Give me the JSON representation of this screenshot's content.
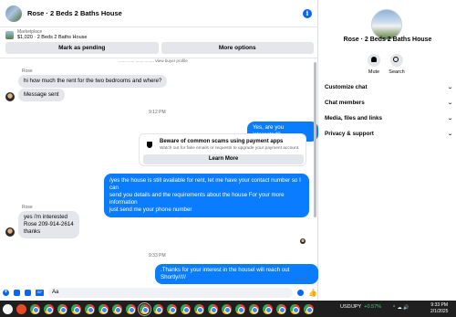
{
  "header": {
    "title": "Rose · 2 Beds 2 Baths House"
  },
  "listing": {
    "label": "Marketplace",
    "price_title": "$1,020 · 2 Beds 2 Baths House"
  },
  "actions": {
    "mark_pending": "Mark as pending",
    "more_options": "More options"
  },
  "thread": {
    "notice_top": "....... ...... ....... ........ View buyer profile",
    "msg1_sender": "Rose",
    "msg1_a": "hi how much the rent for the two bedrooms and where?",
    "msg1_b": "Message sent",
    "time1": "9:12 PM",
    "out1": "Yes, are you interested?",
    "scam_title": "Beware of common scams using payment apps",
    "scam_body": "Watch out for fake emails or requests to upgrade your payment account.",
    "learn_more": "Learn More",
    "out2_l1": "/yes the house is still available for rent, let me have your contact number so I can",
    "out2_l2": "send you details and the requirements about the house For  your  more  information",
    "out2_l3": "just  send  me   your  phone  number",
    "msg2_sender": "Rose",
    "msg2_l1": "yes i'm interested",
    "msg2_l2": "Rose 209-914-2614",
    "msg2_l3": "thanks",
    "time2": "9:33 PM",
    "out3": ".Thanks for your interest in the housel will reach out Shortly/////",
    "sent_status": "Sent"
  },
  "composer": {
    "value": "Aa",
    "gif": "GIF"
  },
  "side": {
    "title": "Rose · 2 Beds 2 Baths House",
    "mute": "Mute",
    "search": "Search",
    "sections": [
      "Customize chat",
      "Chat members",
      "Media, files and links",
      "Privacy & support"
    ]
  },
  "taskbar": {
    "ticker_symbol": "USD/JPY",
    "ticker_change": "+0.57%",
    "clock_time": "9:33 PM",
    "clock_date": "2/1/2025"
  },
  "colors": {
    "accent": "#0a7cff",
    "bubble_in": "#e4e6eb",
    "taskbar": "#1f1f1f"
  },
  "icons": [
    "info-icon",
    "shield-icon",
    "bell-icon",
    "search-icon",
    "plus-icon",
    "image-icon",
    "sticker-icon",
    "gif-icon",
    "emoji-icon",
    "like-icon",
    "chevron-down-icon"
  ]
}
